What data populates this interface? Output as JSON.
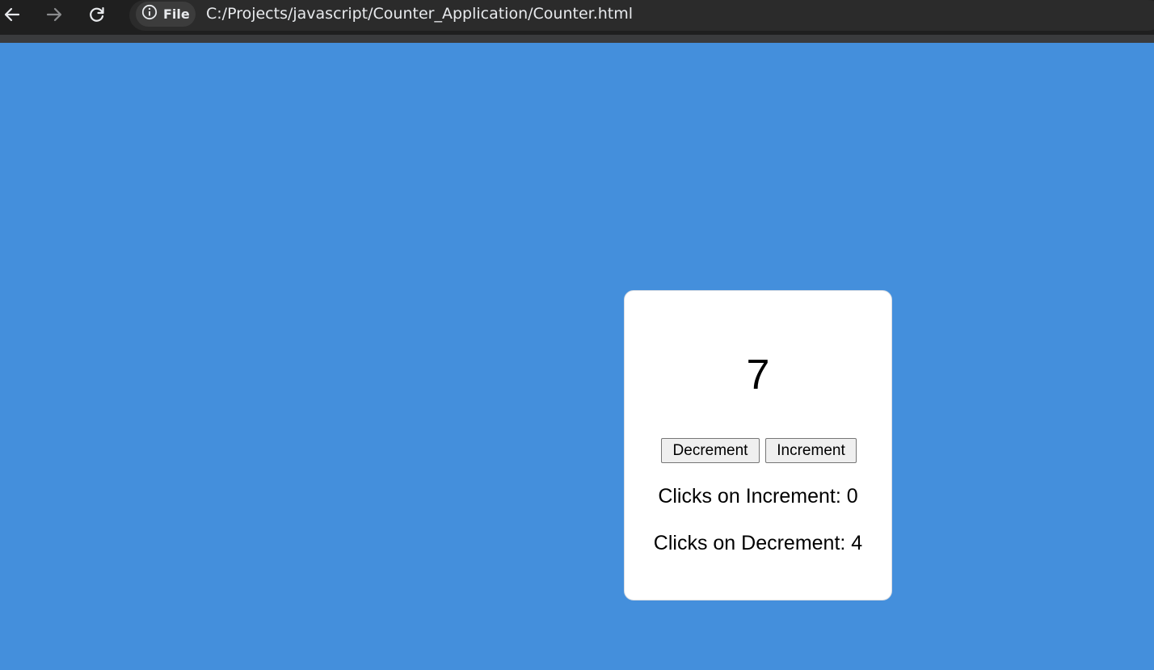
{
  "browser": {
    "back_icon": "arrow-left-icon",
    "forward_icon": "arrow-right-icon",
    "reload_icon": "reload-icon",
    "info_icon": "info-icon",
    "site_chip_label": "File",
    "url": "C:/Projects/javascript/Counter_Application/Counter.html"
  },
  "page": {
    "background_color": "#448fdc",
    "counter_value": "7",
    "decrement_label": "Decrement",
    "increment_label": "Increment",
    "increment_clicks_text": "Clicks on Increment: 0",
    "decrement_clicks_text": "Clicks on Decrement: 4"
  }
}
